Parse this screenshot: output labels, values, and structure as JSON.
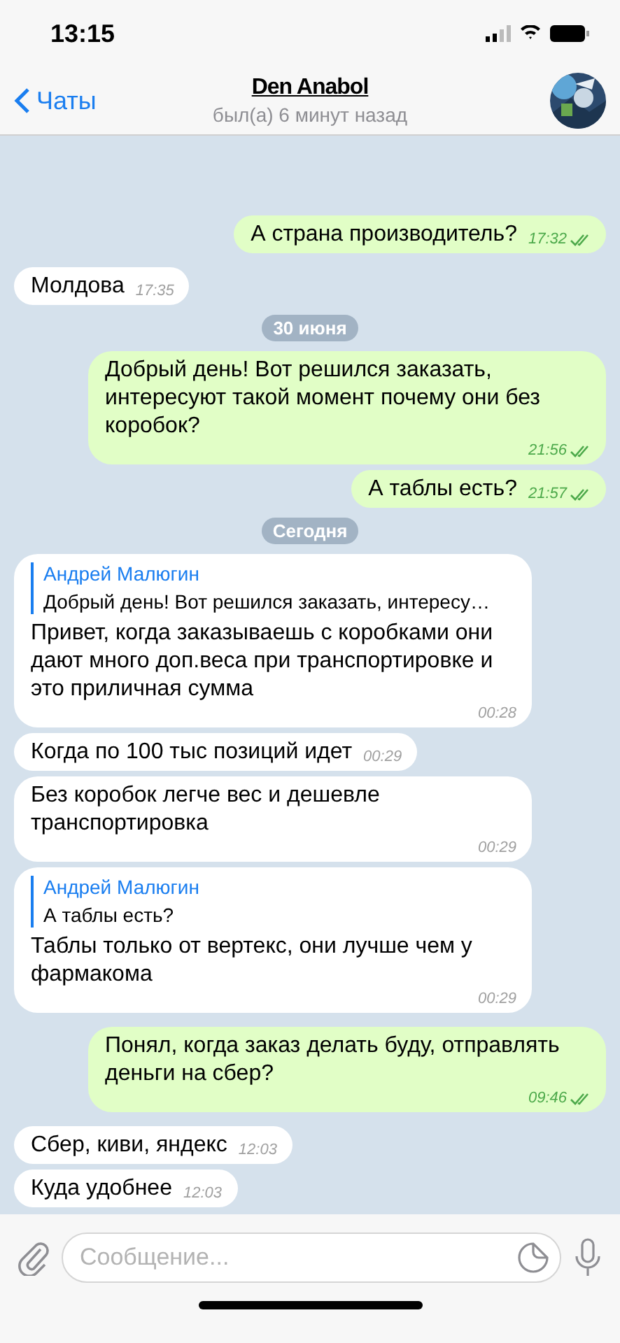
{
  "status_bar": {
    "time": "13:15"
  },
  "header": {
    "back_label": "Чаты",
    "title": "Den Anabol",
    "subtitle": "был(а) 6 минут назад"
  },
  "messages": [
    {
      "kind": "out",
      "text": "А страна производитель?",
      "time": "17:32",
      "read": true
    },
    {
      "kind": "in",
      "text": "Молдова",
      "time": "17:35"
    },
    {
      "kind": "date",
      "text": "30 июня"
    },
    {
      "kind": "out",
      "text": "Добрый день! Вот решился заказать, интересуют такой момент почему они без коробок?",
      "time": "21:56",
      "read": true
    },
    {
      "kind": "out",
      "text": "А таблы есть?",
      "time": "21:57",
      "read": true
    },
    {
      "kind": "date",
      "text": "Сегодня"
    },
    {
      "kind": "in",
      "reply": {
        "author": "Андрей Малюгин",
        "text": "Добрый день! Вот решился заказать, интересу…"
      },
      "text": "Привет, когда заказываешь с коробками они дают много доп.веса при транспортировке и это приличная сумма",
      "time": "00:28"
    },
    {
      "kind": "in",
      "text": "Когда по 100 тыс позиций идет",
      "time": "00:29"
    },
    {
      "kind": "in",
      "text": "Без коробок легче вес и дешевле транспортировка",
      "time": "00:29"
    },
    {
      "kind": "in",
      "reply": {
        "author": "Андрей Малюгин",
        "text": "А таблы есть?"
      },
      "text": "Таблы только от вертекс, они лучше чем у фармакома",
      "time": "00:29"
    },
    {
      "kind": "out",
      "text": "Понял, когда заказ делать буду, отправлять деньги на сбер?",
      "time": "09:46",
      "read": true
    },
    {
      "kind": "in",
      "text": "Сбер, киви, яндекс",
      "time": "12:03"
    },
    {
      "kind": "in",
      "text": "Куда удобнее",
      "time": "12:03"
    }
  ],
  "composer": {
    "placeholder": "Сообщение..."
  }
}
